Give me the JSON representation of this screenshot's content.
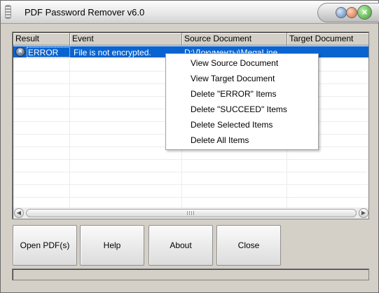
{
  "window": {
    "title": "PDF Password Remover v6.0",
    "close_glyph": "×"
  },
  "list": {
    "columns": [
      "Result",
      "Event",
      "Source Document",
      "Target Document"
    ],
    "rows": [
      {
        "result": "ERROR",
        "event": "File is not encrypted.",
        "source": "D:\\Документы\\MegaLine",
        "target": ""
      }
    ]
  },
  "context_menu": {
    "items": [
      "View Source Document",
      "View Target Document",
      "Delete \"ERROR\" Items",
      "Delete \"SUCCEED\" Items",
      "Delete Selected Items",
      "Delete All Items"
    ]
  },
  "buttons": {
    "open": "Open PDF(s)",
    "help": "Help",
    "about": "About",
    "close": "Close"
  },
  "status": {
    "text": ""
  },
  "icons": {
    "error": "error-icon",
    "scroll_left": "arrow-left-icon",
    "scroll_right": "arrow-right-icon"
  },
  "colors": {
    "selection": "#0a64d0",
    "face": "#d4d0c8"
  }
}
